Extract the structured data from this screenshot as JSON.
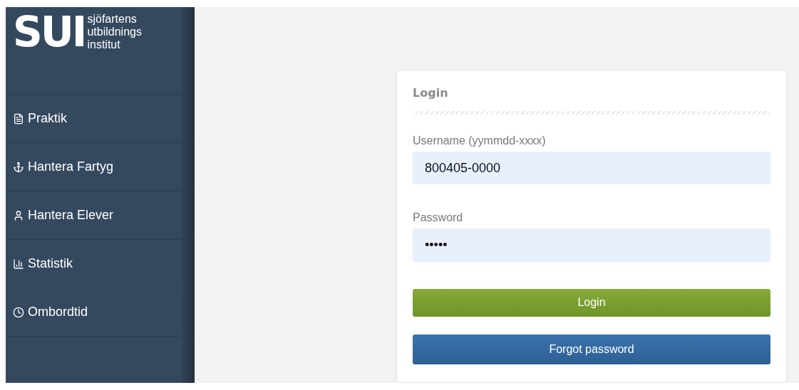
{
  "logo": {
    "mark": "SUI",
    "lines": [
      "sjöfartens",
      "utbildnings",
      "institut"
    ]
  },
  "sidebar": {
    "items": [
      {
        "label": "Praktik"
      },
      {
        "label": "Hantera Fartyg"
      },
      {
        "label": "Hantera Elever"
      },
      {
        "label": "Statistik"
      },
      {
        "label": "Ombordtid"
      }
    ]
  },
  "login": {
    "title": "Login",
    "fields": [
      {
        "label": "Username (yymmdd-xxxx)",
        "value": "800405-0000"
      },
      {
        "label": "Password",
        "value": "•••••"
      }
    ],
    "buttons": [
      {
        "label": "Login",
        "kind": "primary"
      },
      {
        "label": "Forgot password",
        "kind": "secondary"
      }
    ]
  }
}
